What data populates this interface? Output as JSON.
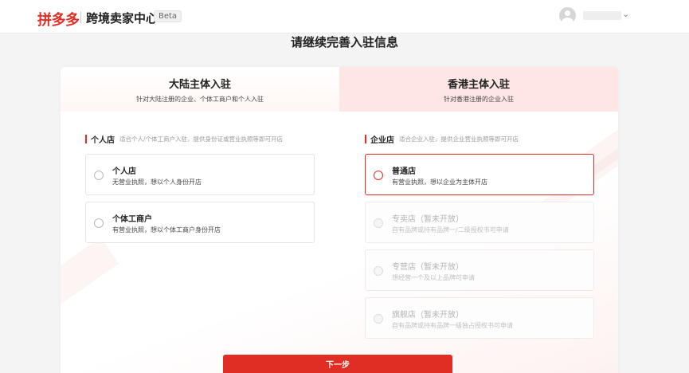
{
  "header": {
    "logo": "拼多多",
    "portal_title": "跨境卖家中心",
    "beta": "Beta",
    "user_icon": "user-avatar-icon",
    "dropdown_icon": "chevron-down-icon"
  },
  "page": {
    "title": "请继续完善入驻信息"
  },
  "tabs": [
    {
      "title": "大陆主体入驻",
      "subtitle": "针对大陆注册的企业、个体工商户和个人入驻",
      "active": true
    },
    {
      "title": "香港主体入驻",
      "subtitle": "针对香港注册的企业入驻",
      "active": false
    }
  ],
  "personal": {
    "label": "个人店",
    "hint": "适合个人/个体工商户入驻，提供身份证或营业执照等即可开店",
    "options": [
      {
        "title": "个人店",
        "desc": "无营业执照，想以个人身份开店",
        "selected": false,
        "disabled": false
      },
      {
        "title": "个体工商户",
        "desc": "有营业执照，想以个体工商户身份开店",
        "selected": false,
        "disabled": false
      }
    ]
  },
  "enterprise": {
    "label": "企业店",
    "hint": "适合企业入驻，提供企业营业执照等即可开店",
    "options": [
      {
        "title": "普通店",
        "desc": "有营业执照，想以企业为主体开店",
        "selected": true,
        "disabled": false
      },
      {
        "title": "专卖店（暂未开放）",
        "desc": "自有品牌或持有品牌一/二级授权书可申请",
        "selected": false,
        "disabled": true
      },
      {
        "title": "专营店（暂未开放）",
        "desc": "想经营一个及以上品牌可申请",
        "selected": false,
        "disabled": true
      },
      {
        "title": "旗舰店（暂未开放）",
        "desc": "自有品牌或持有品牌一级独占授权书可申请",
        "selected": false,
        "disabled": true
      }
    ]
  },
  "actions": {
    "next_label": "下一步"
  },
  "colors": {
    "accent": "#e02e24",
    "hk_tab_bg": "#fde6e4",
    "page_bg": "#f4f4f5"
  }
}
